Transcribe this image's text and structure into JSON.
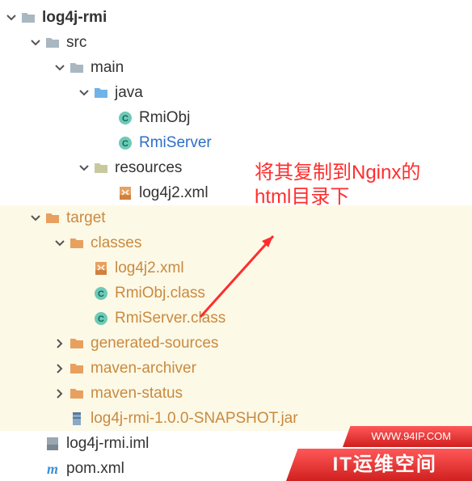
{
  "tree": {
    "root": {
      "label": "log4j-rmi"
    },
    "src": {
      "label": "src"
    },
    "main": {
      "label": "main"
    },
    "java": {
      "label": "java"
    },
    "rmiObj": {
      "label": "RmiObj"
    },
    "rmiServer": {
      "label": "RmiServer"
    },
    "resources": {
      "label": "resources"
    },
    "log4j2_res": {
      "label": "log4j2.xml"
    },
    "target": {
      "label": "target"
    },
    "classes": {
      "label": "classes"
    },
    "log4j2_cls": {
      "label": "log4j2.xml"
    },
    "rmiObjCls": {
      "label": "RmiObj.class"
    },
    "rmiServerCls": {
      "label": "RmiServer.class"
    },
    "generated": {
      "label": "generated-sources"
    },
    "archiver": {
      "label": "maven-archiver"
    },
    "status": {
      "label": "maven-status"
    },
    "jar": {
      "label": "log4j-rmi-1.0.0-SNAPSHOT.jar"
    },
    "iml": {
      "label": "log4j-rmi.iml"
    },
    "pom": {
      "label": "pom.xml"
    }
  },
  "annotation": {
    "line1": "将其复制到Nginx的",
    "line2": "html目录下"
  },
  "badge": {
    "url": "WWW.94IP.COM",
    "name": "IT运维空间"
  }
}
